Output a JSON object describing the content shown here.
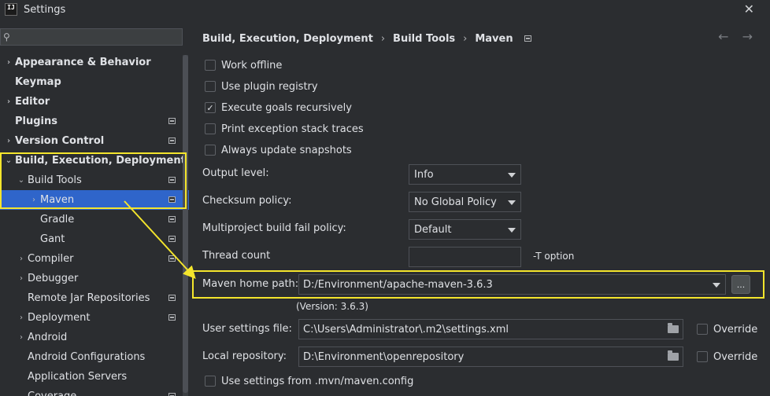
{
  "window": {
    "app_logo": "IJ",
    "title": "Settings",
    "close_icon": "close-icon"
  },
  "sidebar": {
    "search_placeholder": "",
    "items": [
      {
        "label": "Appearance & Behavior",
        "arrow": "›",
        "bold": true,
        "indent": 0
      },
      {
        "label": "Keymap",
        "arrow": "",
        "bold": true,
        "indent": 0
      },
      {
        "label": "Editor",
        "arrow": "›",
        "bold": true,
        "indent": 0
      },
      {
        "label": "Plugins",
        "arrow": "",
        "bold": true,
        "indent": 0,
        "marker": true
      },
      {
        "label": "Version Control",
        "arrow": "›",
        "bold": true,
        "indent": 0,
        "marker": true
      },
      {
        "label": "Build, Execution, Deployment",
        "arrow": "⌄",
        "bold": true,
        "indent": 0
      },
      {
        "label": "Build Tools",
        "arrow": "⌄",
        "bold": false,
        "indent": 1,
        "marker": true
      },
      {
        "label": "Maven",
        "arrow": "›",
        "bold": false,
        "indent": 2,
        "marker": true,
        "selected": true
      },
      {
        "label": "Gradle",
        "arrow": "",
        "bold": false,
        "indent": 2,
        "marker": true
      },
      {
        "label": "Gant",
        "arrow": "",
        "bold": false,
        "indent": 2,
        "marker": true
      },
      {
        "label": "Compiler",
        "arrow": "›",
        "bold": false,
        "indent": 1,
        "marker": true
      },
      {
        "label": "Debugger",
        "arrow": "›",
        "bold": false,
        "indent": 1
      },
      {
        "label": "Remote Jar Repositories",
        "arrow": "",
        "bold": false,
        "indent": 1,
        "marker": true
      },
      {
        "label": "Deployment",
        "arrow": "›",
        "bold": false,
        "indent": 1,
        "marker": true
      },
      {
        "label": "Android",
        "arrow": "›",
        "bold": false,
        "indent": 1
      },
      {
        "label": "Android Configurations",
        "arrow": "",
        "bold": false,
        "indent": 1
      },
      {
        "label": "Application Servers",
        "arrow": "",
        "bold": false,
        "indent": 1
      },
      {
        "label": "Coverage",
        "arrow": "",
        "bold": false,
        "indent": 1,
        "marker": true
      }
    ]
  },
  "breadcrumb": {
    "items": [
      "Build, Execution, Deployment",
      "Build Tools",
      "Maven"
    ],
    "separator": "›",
    "back_arrow": "←",
    "forward_arrow": "→"
  },
  "options": {
    "work_offline": {
      "label": "Work offline",
      "checked": false
    },
    "use_plugin_registry": {
      "label": "Use plugin registry",
      "checked": false
    },
    "execute_goals_recursively": {
      "label": "Execute goals recursively",
      "checked": true
    },
    "print_exception_stack_traces": {
      "label": "Print exception stack traces",
      "checked": false
    },
    "always_update_snapshots": {
      "label": "Always update snapshots",
      "checked": false
    }
  },
  "fields": {
    "output_level": {
      "label": "Output level:",
      "value": "Info"
    },
    "checksum_policy": {
      "label": "Checksum policy:",
      "value": "No Global Policy"
    },
    "multiproject_fail_policy": {
      "label": "Multiproject build fail policy:",
      "value": "Default"
    },
    "thread_count": {
      "label": "Thread count",
      "value": "",
      "suffix": "-T option"
    },
    "maven_home_path": {
      "label": "Maven home path:",
      "value": "D:/Environment/apache-maven-3.6.3",
      "version": "(Version: 3.6.3)",
      "browse": "..."
    },
    "user_settings_file": {
      "label": "User settings file:",
      "value": "C:\\Users\\Administrator\\.m2\\settings.xml",
      "override_label": "Override"
    },
    "local_repository": {
      "label": "Local repository:",
      "value": "D:\\Environment\\openrepository",
      "override_label": "Override"
    },
    "use_mvn_config": {
      "label": "Use settings from .mvn/maven.config",
      "checked": false
    }
  },
  "colors": {
    "background": "#2b2d30",
    "selection": "#2f65ca",
    "annotation": "#f4e52c"
  }
}
